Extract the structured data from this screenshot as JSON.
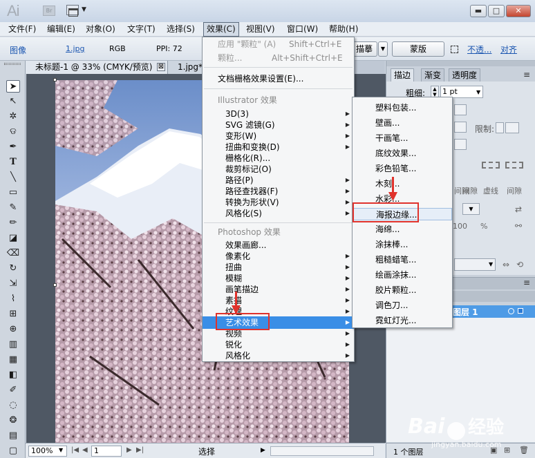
{
  "app": {
    "logo_text": "Ai",
    "bridge_badge": "Br"
  },
  "window_controls": {
    "minimize": "▬",
    "maximize": "□",
    "close": "✕"
  },
  "menubar": [
    "文件(F)",
    "编辑(E)",
    "对象(O)",
    "文字(T)",
    "选择(S)",
    "效果(C)",
    "视图(V)",
    "窗口(W)",
    "帮助(H)"
  ],
  "controlbar": {
    "type_label": "图像",
    "file_name": "1.jpg",
    "color_mode": "RGB",
    "ppi": "PPI: 72",
    "trace_btn": "描摹",
    "mask_btn": "蒙版",
    "opacity_link": "不透...",
    "align_link": "对齐"
  },
  "doc_tabs": [
    {
      "title": "未标题-1 @ 33% (CMYK/预览)",
      "close": "⊠"
    },
    {
      "title": "1.jpg*"
    }
  ],
  "statusbar": {
    "zoom": "100%",
    "page": "1",
    "status": "选择"
  },
  "right_panel": {
    "tabs": [
      "描边",
      "渐变",
      "透明度"
    ],
    "stroke_weight_label": "粗细:",
    "stroke_weight_value": "1 pt",
    "limit_label": "限制:",
    "dash_labels": [
      "间隙",
      "虚线",
      "间隙"
    ],
    "fragments": [
      "间隙",
      "100",
      "%"
    ],
    "layer_name": "图层 1",
    "layer_count": "1 个图层"
  },
  "effect_menu": {
    "apply_last": {
      "label": "应用 \"颗粒\" (A)",
      "shortcut": "Shift+Ctrl+E"
    },
    "last_effect": {
      "label": "颗粒...",
      "shortcut": "Alt+Shift+Ctrl+E"
    },
    "doc_raster_settings": "文档栅格效果设置(E)...",
    "illustrator_header": "Illustrator 效果",
    "illustrator_items": [
      "3D(3)",
      "SVG 滤镜(G)",
      "变形(W)",
      "扭曲和变换(D)",
      "栅格化(R)...",
      "裁剪标记(O)",
      "路径(P)",
      "路径查找器(F)",
      "转换为形状(V)",
      "风格化(S)"
    ],
    "photoshop_header": "Photoshop 效果",
    "photoshop_items": [
      "效果画廊...",
      "像素化",
      "扭曲",
      "模糊",
      "画笔描边",
      "素描",
      "纹理",
      "艺术效果",
      "视频",
      "锐化",
      "风格化"
    ],
    "highlighted": "艺术效果"
  },
  "artistic_submenu": {
    "items": [
      "塑料包装...",
      "壁画...",
      "干画笔...",
      "底纹效果...",
      "彩色铅笔...",
      "木刻...",
      "水彩...",
      "海报边缘...",
      "海绵...",
      "涂抹棒...",
      "粗糙蜡笔...",
      "绘画涂抹...",
      "胶片颗粒...",
      "调色刀...",
      "霓虹灯光..."
    ],
    "highlighted": "海报边缘..."
  },
  "watermark": {
    "brand": "Bai",
    "brand_suffix": "经验",
    "url": "jingyan.baidu.com"
  }
}
